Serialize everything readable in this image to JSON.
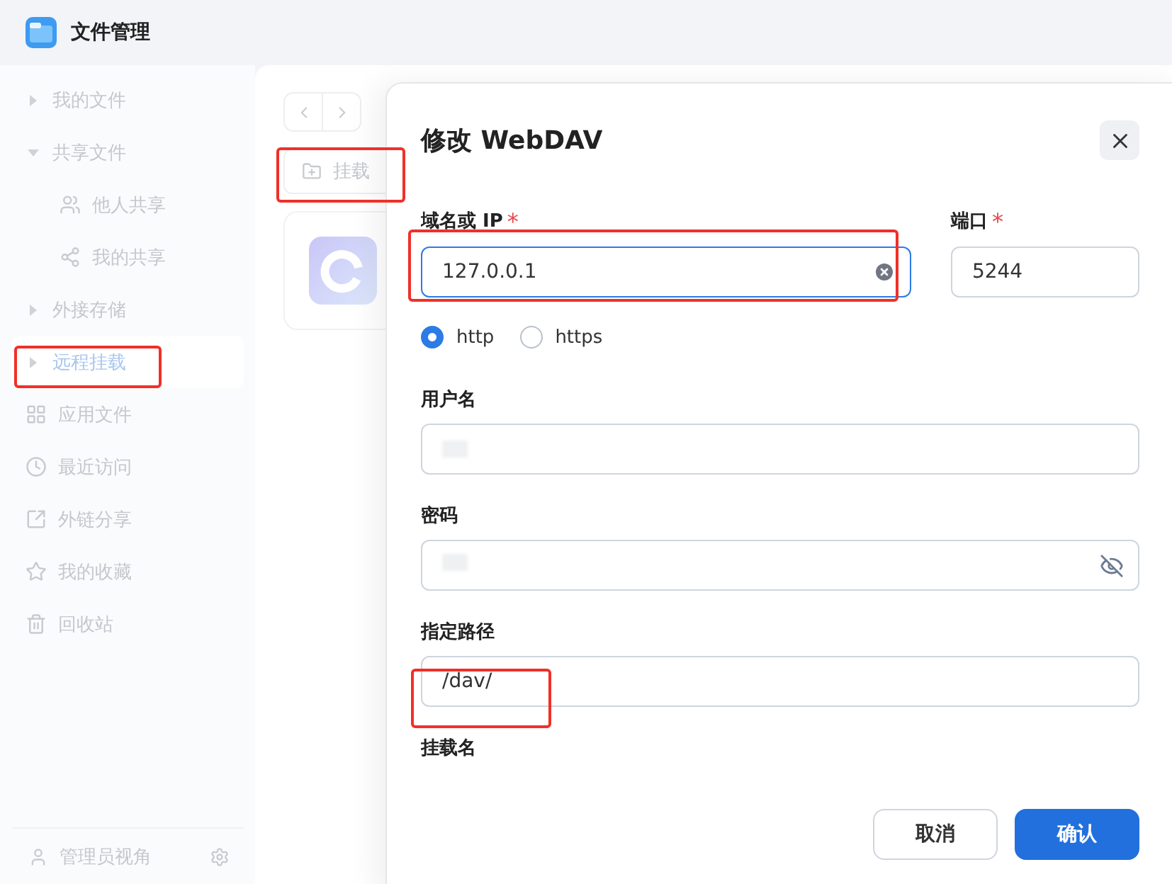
{
  "window": {
    "title": "文件管理"
  },
  "sidebar": {
    "items": [
      {
        "label": "我的文件",
        "kind": "group",
        "expanded": false,
        "selected": false
      },
      {
        "label": "共享文件",
        "kind": "group",
        "expanded": true,
        "selected": false,
        "children": [
          {
            "label": "他人共享",
            "selected": false
          },
          {
            "label": "我的共享",
            "selected": false
          }
        ]
      },
      {
        "label": "外接存储",
        "kind": "group",
        "expanded": false,
        "selected": false
      },
      {
        "label": "远程挂载",
        "kind": "group",
        "expanded": false,
        "selected": true
      },
      {
        "label": "应用文件",
        "kind": "link",
        "selected": false
      },
      {
        "label": "最近访问",
        "kind": "link",
        "selected": false
      },
      {
        "label": "外链分享",
        "kind": "link",
        "selected": false
      },
      {
        "label": "我的收藏",
        "kind": "link",
        "selected": false
      },
      {
        "label": "回收站",
        "kind": "link",
        "selected": false
      }
    ],
    "footer": {
      "label": "管理员视角"
    }
  },
  "toolbar": {
    "mount_button": "挂载"
  },
  "dialog": {
    "title": "修改 WebDAV",
    "host": {
      "label": "域名或 IP",
      "marker": "*",
      "value": "127.0.0.1",
      "focused": true
    },
    "port": {
      "label": "端口",
      "marker": "*",
      "value": "5244",
      "focused": false
    },
    "protocols": [
      {
        "label": "http",
        "selected": true
      },
      {
        "label": "https",
        "selected": false
      }
    ],
    "username": {
      "label": "用户名"
    },
    "password": {
      "label": "密码"
    },
    "path": {
      "label": "指定路径",
      "value": "/dav/"
    },
    "mount_name": {
      "label": "挂载名"
    },
    "buttons": [
      {
        "label": "取消",
        "kind": "secondary"
      },
      {
        "label": "确认",
        "kind": "primary"
      }
    ]
  }
}
